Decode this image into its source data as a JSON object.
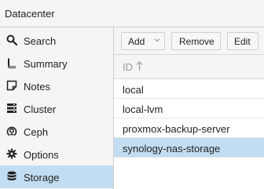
{
  "window": {
    "title": "Datacenter"
  },
  "sidebar": {
    "items": [
      {
        "label": "Search",
        "icon": "search-icon",
        "selected": false
      },
      {
        "label": "Summary",
        "icon": "book-icon",
        "selected": false
      },
      {
        "label": "Notes",
        "icon": "note-icon",
        "selected": false
      },
      {
        "label": "Cluster",
        "icon": "server-icon",
        "selected": false
      },
      {
        "label": "Ceph",
        "icon": "ceph-icon",
        "selected": false
      },
      {
        "label": "Options",
        "icon": "gear-icon",
        "selected": false
      },
      {
        "label": "Storage",
        "icon": "database-icon",
        "selected": true
      }
    ]
  },
  "toolbar": {
    "add_label": "Add",
    "remove_label": "Remove",
    "edit_label": "Edit"
  },
  "grid": {
    "column_header": "ID",
    "sort": "ascending",
    "rows": [
      {
        "id": "local",
        "selected": false
      },
      {
        "id": "local-lvm",
        "selected": false
      },
      {
        "id": "proxmox-backup-server",
        "selected": false
      },
      {
        "id": "synology-nas-storage",
        "selected": true
      }
    ]
  },
  "colors": {
    "selection": "#c2ddf2",
    "panel_bg": "#f5f5f5",
    "border": "#cfcfcf"
  }
}
